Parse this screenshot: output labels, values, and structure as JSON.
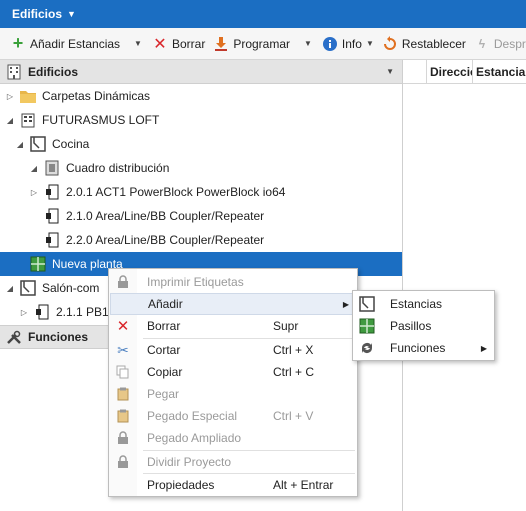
{
  "title": "Edificios",
  "toolbar": {
    "add_rooms": "Añadir Estancias",
    "delete": "Borrar",
    "program": "Programar",
    "info": "Info",
    "reset": "Restablecer",
    "unload": "Despr"
  },
  "left_panel": {
    "header": "Edificios",
    "tree": [
      {
        "label": "Carpetas Dinámicas"
      },
      {
        "label": "FUTURASMUS LOFT"
      },
      {
        "label": "Cocina"
      },
      {
        "label": "Cuadro distribución"
      },
      {
        "label": "2.0.1 ACT1 PowerBlock PowerBlock io64"
      },
      {
        "label": "2.1.0 Area/Line/BB Coupler/Repeater"
      },
      {
        "label": "2.2.0 Area/Line/BB Coupler/Repeater"
      },
      {
        "label": "Nueva planta"
      },
      {
        "label": "Salón-com"
      },
      {
        "label": "2.1.1 PB1"
      }
    ],
    "functions_header": "Funciones"
  },
  "right_panel": {
    "col_direccion": "Direcció",
    "col_estancia": "Estancia"
  },
  "context_menu": {
    "items": [
      {
        "label": "Imprimir Etiquetas",
        "shortcut": ""
      },
      {
        "label": "Añadir",
        "shortcut": ""
      },
      {
        "label": "Borrar",
        "shortcut": "Supr"
      },
      {
        "label": "Cortar",
        "shortcut": "Ctrl + X"
      },
      {
        "label": "Copiar",
        "shortcut": "Ctrl + C"
      },
      {
        "label": "Pegar",
        "shortcut": ""
      },
      {
        "label": "Pegado Especial",
        "shortcut": "Ctrl + V"
      },
      {
        "label": "Pegado Ampliado",
        "shortcut": ""
      },
      {
        "label": "Dividir Proyecto",
        "shortcut": ""
      },
      {
        "label": "Propiedades",
        "shortcut": "Alt + Entrar"
      }
    ]
  },
  "submenu": {
    "items": [
      {
        "label": "Estancias"
      },
      {
        "label": "Pasillos"
      },
      {
        "label": "Funciones"
      }
    ]
  },
  "colors": {
    "accent": "#1b6ec2",
    "delete_red": "#d9262b",
    "add_green": "#3aa13a"
  }
}
